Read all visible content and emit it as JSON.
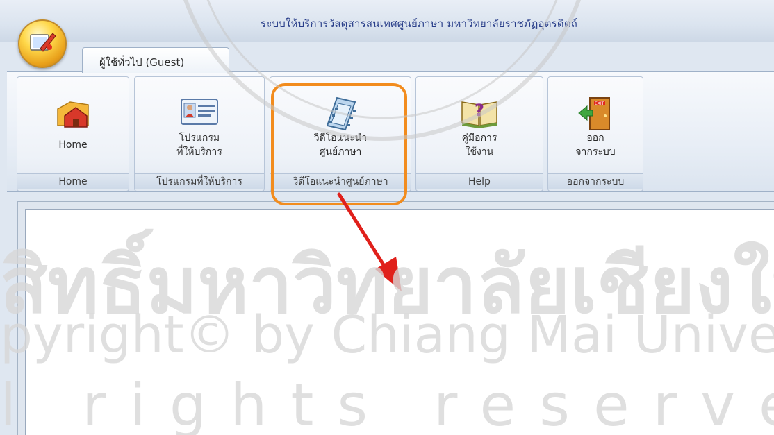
{
  "window": {
    "title": "ระบบให้บริการวัสดุสารสนเทศศูนย์ภาษา มหาวิทยาลัยราชภัฏอุตรดิตถ์"
  },
  "ribbon": {
    "tab_label": "ผู้ใช้ทั่วไป (Guest)",
    "groups": [
      {
        "button_line1": "Home",
        "button_line2": "",
        "group_label": "Home",
        "icon": "home-folder-icon"
      },
      {
        "button_line1": "โปรแกรม",
        "button_line2": "ที่ให้บริการ",
        "group_label": "โปรแกรมที่ให้บริการ",
        "icon": "contact-card-icon"
      },
      {
        "button_line1": "วิดีโอแนะนำ",
        "button_line2": "ศูนย์ภาษา",
        "group_label": "วิดีโอแนะนำศูนย์ภาษา",
        "icon": "film-strip-icon"
      },
      {
        "button_line1": "คู่มือการ",
        "button_line2": "ใช้งาน",
        "group_label": "Help",
        "icon": "help-book-icon"
      },
      {
        "button_line1": "ออก",
        "button_line2": "จากระบบ",
        "group_label": "ออกจากระบบ",
        "icon": "exit-door-icon"
      }
    ]
  },
  "watermark": {
    "line1": "สิทธิ์มหาวิทยาลัยเชียงใหม่",
    "line2": "pyright© by Chiang Mai University",
    "line3": "l rights reserved"
  },
  "colors": {
    "highlight": "#f28c1e",
    "arrow": "#e0201b",
    "title_text": "#2a3f8a"
  }
}
